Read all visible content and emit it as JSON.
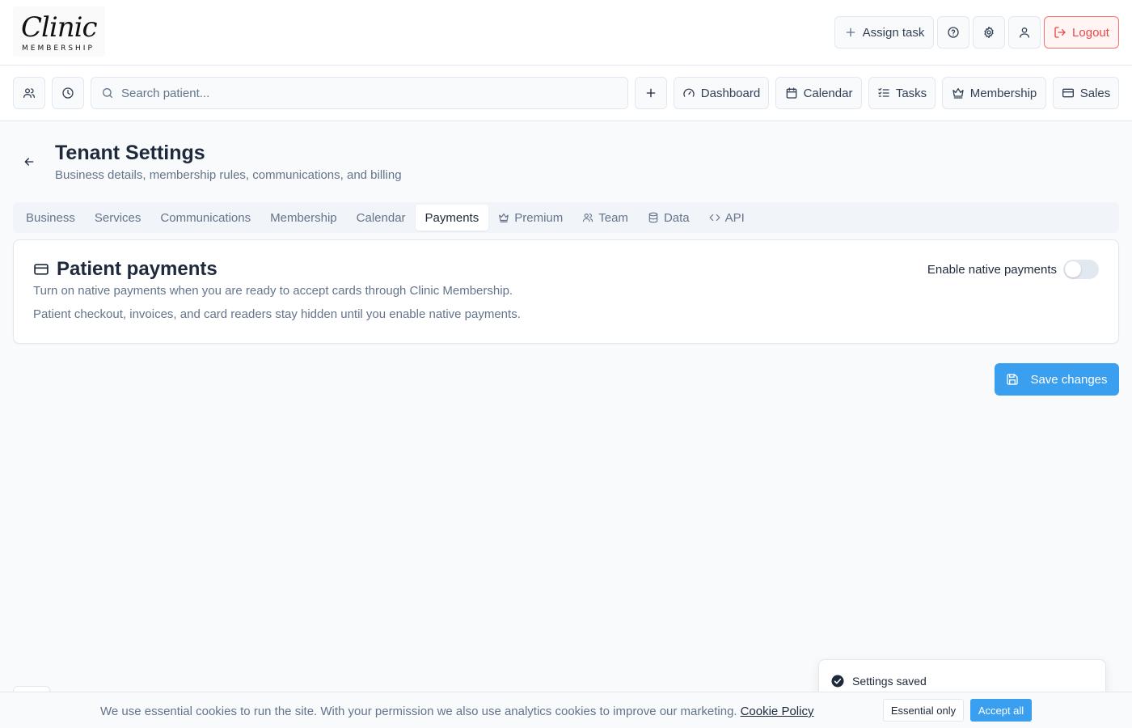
{
  "brand": {
    "script": "Clinic",
    "sub": "MEMBERSHIP"
  },
  "header": {
    "assign_task_label": "Assign task",
    "logout_label": "Logout"
  },
  "toolbar": {
    "search_placeholder": "Search patient...",
    "nav": {
      "dashboard": "Dashboard",
      "calendar": "Calendar",
      "tasks": "Tasks",
      "membership": "Membership",
      "sales": "Sales"
    }
  },
  "page": {
    "title": "Tenant Settings",
    "subtitle": "Business details, membership rules, communications, and billing"
  },
  "tabs": {
    "business": "Business",
    "services": "Services",
    "communications": "Communications",
    "membership": "Membership",
    "calendar": "Calendar",
    "payments": "Payments",
    "premium": "Premium",
    "team": "Team",
    "data": "Data",
    "api": "API",
    "active": "Payments"
  },
  "card": {
    "title": "Patient payments",
    "description": "Turn on native payments when you are ready to accept cards through Clinic Membership.",
    "note": "Patient checkout, invoices, and card readers stay hidden until you enable native payments.",
    "toggle_label": "Enable native payments",
    "toggle_on": false
  },
  "save_label": "Save changes",
  "toast": {
    "message": "Settings saved"
  },
  "cookie": {
    "text": "We use essential cookies to run the site. With your permission we also use analytics cookies to improve our marketing.",
    "link": "Cookie Policy",
    "essential_label": "Essential only",
    "accept_label": "Accept all"
  },
  "colors": {
    "primary": "#3b9ff0",
    "danger": "#ef4444",
    "text": "#1e293b",
    "muted": "#64748b",
    "border": "#e2e8f0"
  }
}
